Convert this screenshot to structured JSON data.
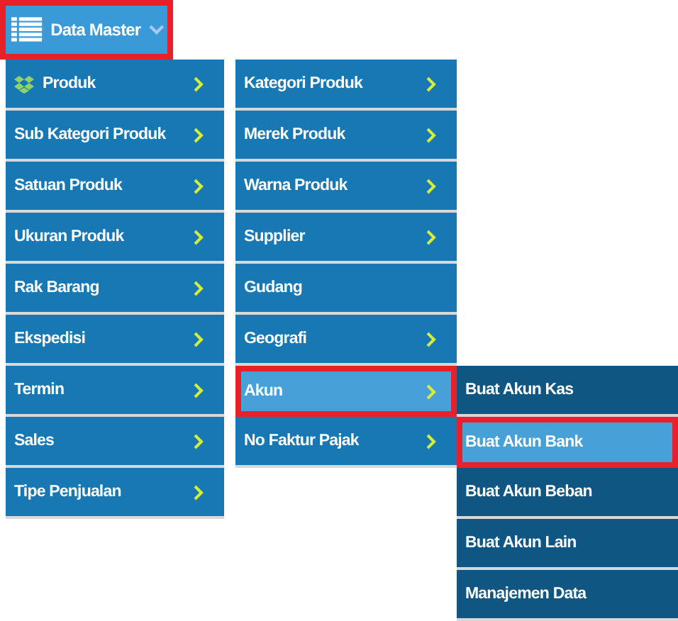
{
  "menu_button": {
    "label": "Data Master",
    "highlighted": true
  },
  "columns": [
    {
      "items": [
        {
          "label": "Produk",
          "icon": true,
          "has_submenu": true,
          "selected": false,
          "highlighted": false
        },
        {
          "label": "Sub Kategori Produk",
          "has_submenu": true,
          "selected": false,
          "highlighted": false
        },
        {
          "label": "Satuan Produk",
          "has_submenu": true,
          "selected": false,
          "highlighted": false
        },
        {
          "label": "Ukuran Produk",
          "has_submenu": true,
          "selected": false,
          "highlighted": false
        },
        {
          "label": "Rak Barang",
          "has_submenu": true,
          "selected": false,
          "highlighted": false
        },
        {
          "label": "Ekspedisi",
          "has_submenu": true,
          "selected": false,
          "highlighted": false
        },
        {
          "label": "Termin",
          "has_submenu": true,
          "selected": false,
          "highlighted": false
        },
        {
          "label": "Sales",
          "has_submenu": true,
          "selected": false,
          "highlighted": false
        },
        {
          "label": "Tipe Penjualan",
          "has_submenu": true,
          "selected": false,
          "highlighted": false
        }
      ]
    },
    {
      "items": [
        {
          "label": "Kategori Produk",
          "has_submenu": true,
          "selected": false,
          "highlighted": false
        },
        {
          "label": "Merek Produk",
          "has_submenu": true,
          "selected": false,
          "highlighted": false
        },
        {
          "label": "Warna Produk",
          "has_submenu": true,
          "selected": false,
          "highlighted": false
        },
        {
          "label": "Supplier",
          "has_submenu": true,
          "selected": false,
          "highlighted": false
        },
        {
          "label": "Gudang",
          "has_submenu": false,
          "selected": false,
          "highlighted": false
        },
        {
          "label": "Geografi",
          "has_submenu": true,
          "selected": false,
          "highlighted": false
        },
        {
          "label": "Akun",
          "has_submenu": true,
          "selected": true,
          "highlighted": true
        },
        {
          "label": "No Faktur Pajak",
          "has_submenu": true,
          "selected": false,
          "highlighted": false
        }
      ]
    },
    {
      "items": [
        {
          "label": "Buat Akun Kas",
          "has_submenu": false,
          "selected": false,
          "highlighted": false
        },
        {
          "label": "Buat Akun Bank",
          "has_submenu": false,
          "selected": true,
          "highlighted": true
        },
        {
          "label": "Buat Akun Beban",
          "has_submenu": false,
          "selected": false,
          "highlighted": false
        },
        {
          "label": "Buat Akun Lain",
          "has_submenu": false,
          "selected": false,
          "highlighted": false
        },
        {
          "label": "Manajemen Data",
          "has_submenu": false,
          "selected": false,
          "highlighted": false
        }
      ]
    }
  ]
}
